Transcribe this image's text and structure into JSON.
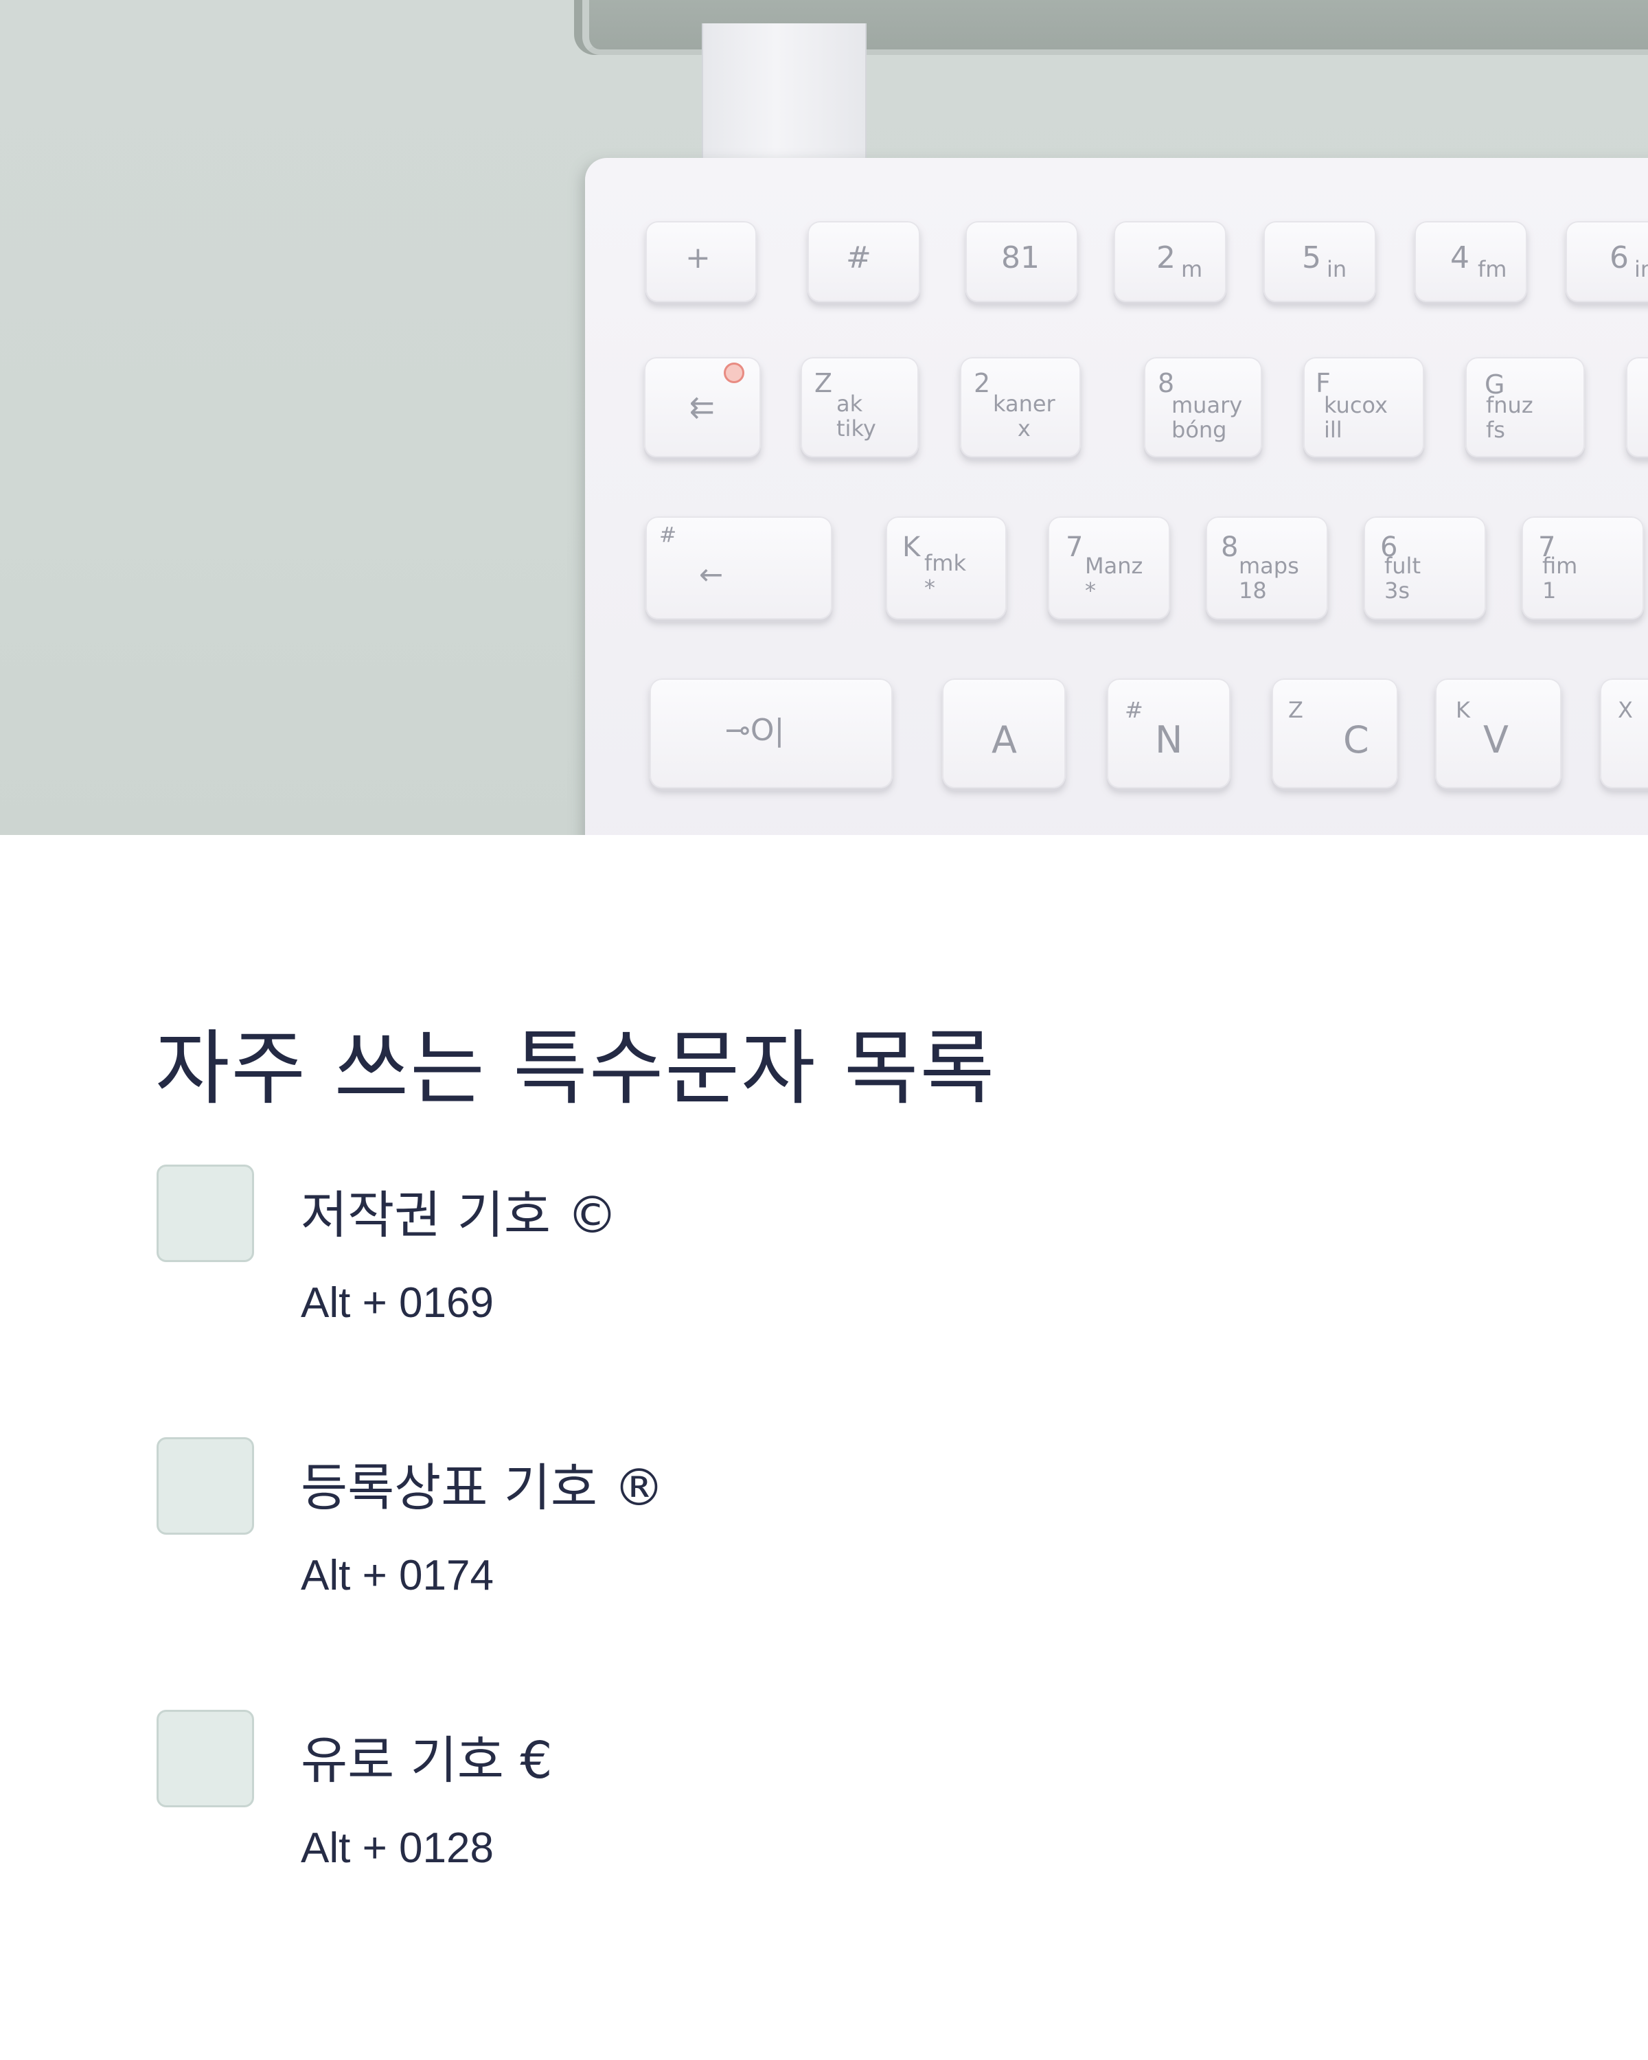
{
  "hero_image": {
    "subject": "white laptop keyboard",
    "keys": [
      {
        "main": "+",
        "sub": ""
      },
      {
        "main": "#",
        "sub": ""
      },
      {
        "main": "81",
        "sub": ""
      },
      {
        "main": "2",
        "sub": "m"
      },
      {
        "main": "5",
        "sub": "in"
      },
      {
        "main": "4",
        "sub": "fm"
      },
      {
        "main": "6",
        "sub": "in"
      },
      {
        "main": "⇇",
        "sub": ""
      },
      {
        "main": "Z",
        "sub": "ak\ntiky"
      },
      {
        "main": "2",
        "sub": "kaner\nx"
      },
      {
        "main": "8",
        "sub": "muary\nbóng"
      },
      {
        "main": "F",
        "sub": "kucox\nill"
      },
      {
        "main": "G",
        "sub": "fnuz\nfs"
      },
      {
        "main": "#",
        "sub": "←"
      },
      {
        "main": "K",
        "sub": "fmk\n*"
      },
      {
        "main": "7",
        "sub": "Manz\n*"
      },
      {
        "main": "8",
        "sub": "maps\n18"
      },
      {
        "main": "6",
        "sub": "fult\n3s"
      },
      {
        "main": "7",
        "sub": "fim\n1"
      },
      {
        "main": "⊸O|",
        "sub": ""
      },
      {
        "main": "A",
        "sub": ""
      },
      {
        "main": "N",
        "sub": "#"
      },
      {
        "main": "C",
        "sub": "Z"
      },
      {
        "main": "V",
        "sub": "K"
      },
      {
        "main": "",
        "sub": "X"
      }
    ]
  },
  "page": {
    "title": "자주 쓰는 특수문자 목록"
  },
  "symbols": [
    {
      "name": "저작권 기호 ©",
      "shortcut": "Alt + 0169"
    },
    {
      "name": "등록상표 기호 ®",
      "shortcut": "Alt + 0174"
    },
    {
      "name": "유로 기호 €",
      "shortcut": "Alt + 0128"
    }
  ],
  "colors": {
    "hero_background": "#d0d8d4",
    "swatch_fill": "#e2ebe8",
    "swatch_border": "#c8d5d1",
    "text_primary": "#242a44"
  }
}
